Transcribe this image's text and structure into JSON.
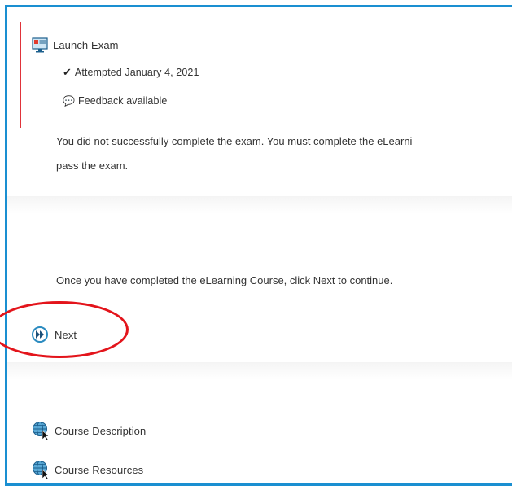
{
  "exam": {
    "launch_label": "Launch Exam",
    "attempted_label": "Attempted January 4, 2021",
    "feedback_label": "Feedback available"
  },
  "message": {
    "line1": "You did not successfully complete the exam. You must complete the eLearni",
    "line2": "pass the exam."
  },
  "instructions": "Once you have completed the eLearning Course, click Next to continue.",
  "next_label": "Next",
  "links": {
    "description": "Course Description",
    "resources": "Course Resources"
  },
  "colors": {
    "border": "#1a8fd1",
    "exam_accent": "#e0333a",
    "annotation": "#e3141b",
    "next_icon": "#2b8bc0"
  }
}
